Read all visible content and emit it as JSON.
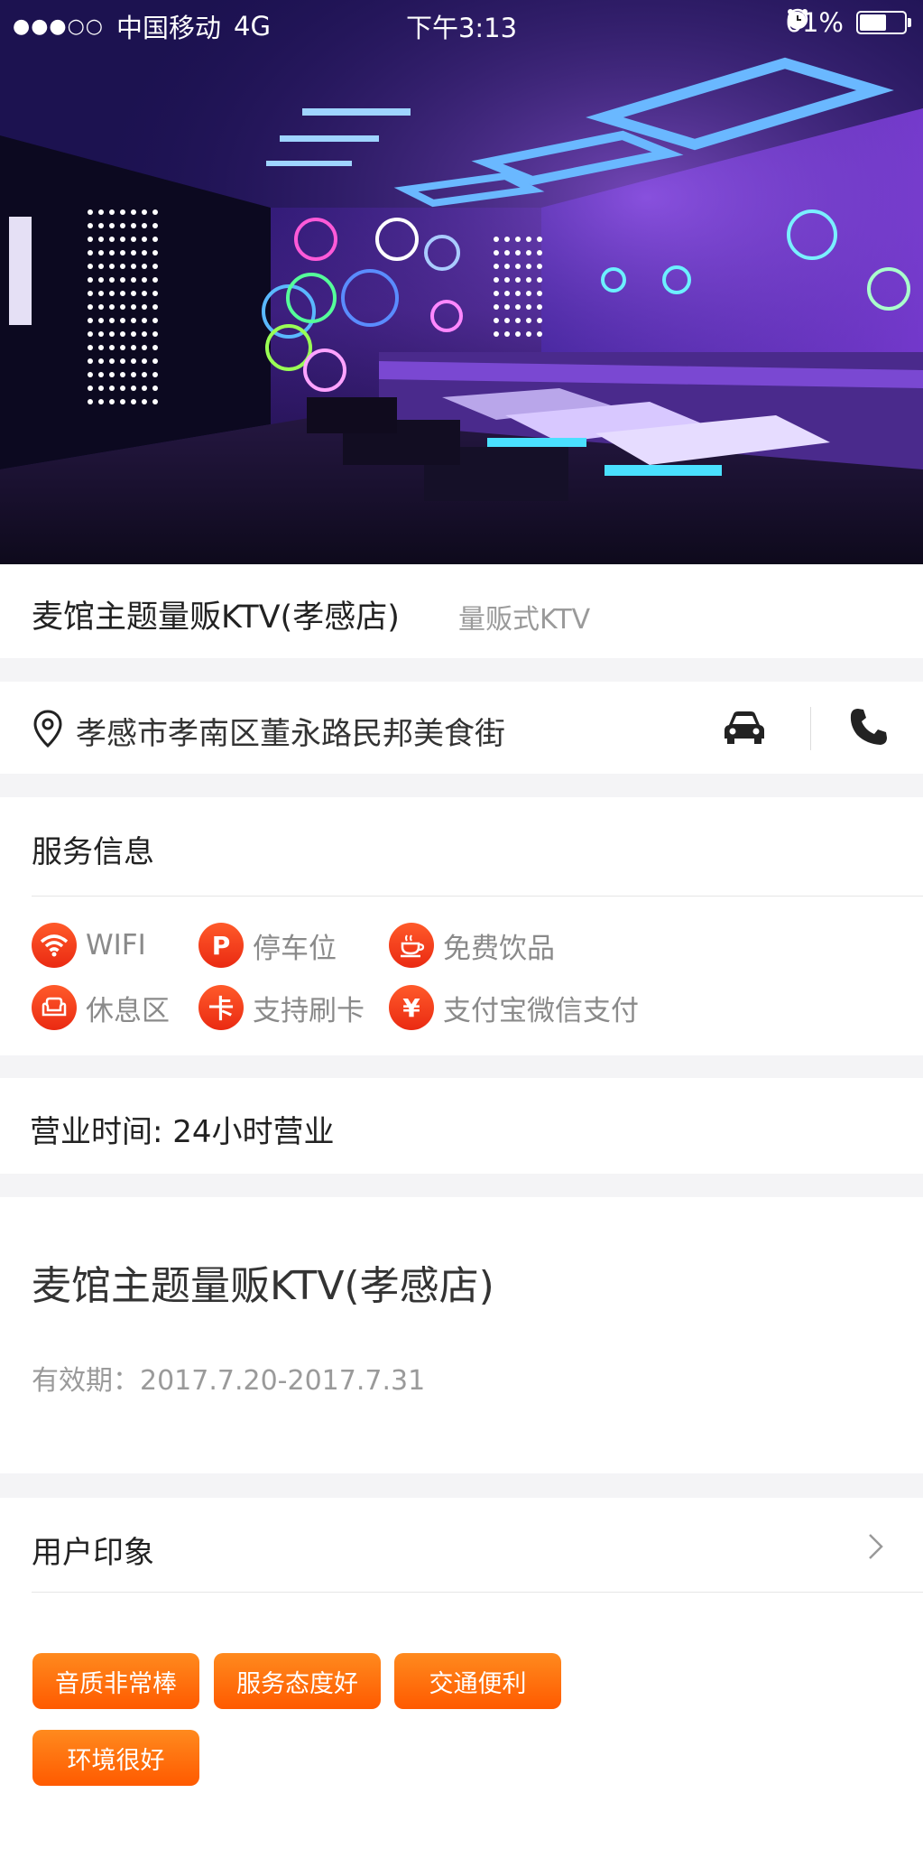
{
  "status_bar": {
    "signal": "●●●○○",
    "carrier": "中国移动",
    "network": "4G",
    "time": "下午3:13",
    "battery": "61%",
    "battery_level": 0.61
  },
  "store": {
    "name": "麦馆主题量贩KTV(孝感店)",
    "category": "量贩式KTV"
  },
  "address": {
    "text": "孝感市孝南区董永路民邦美食街",
    "icons": [
      "location-pin-icon",
      "car-icon",
      "phone-icon"
    ]
  },
  "services": {
    "heading": "服务信息",
    "items": [
      {
        "icon": "wifi-icon",
        "glyph": "",
        "label": "WIFI"
      },
      {
        "icon": "parking-icon",
        "glyph": "P",
        "label": "停车位"
      },
      {
        "icon": "cup-icon",
        "glyph": "",
        "label": "免费饮品"
      },
      {
        "icon": "sofa-icon",
        "glyph": "",
        "label": "休息区"
      },
      {
        "icon": "card-icon",
        "glyph": "卡",
        "label": "支持刷卡"
      },
      {
        "icon": "yuan-icon",
        "glyph": "¥",
        "label": "支付宝微信支付"
      }
    ]
  },
  "hours": {
    "text": "营业时间: 24小时营业"
  },
  "deal": {
    "title": "麦馆主题量贩KTV(孝感店)",
    "validity": "有效期：2017.7.20-2017.7.31"
  },
  "impressions": {
    "heading": "用户印象",
    "tags": [
      "音质非常棒",
      "服务态度好",
      "交通便利",
      "环境很好"
    ]
  },
  "colors": {
    "accent_red": "#ee3316",
    "accent_orange": "#ff6a00",
    "background": "#f4f4f6"
  }
}
